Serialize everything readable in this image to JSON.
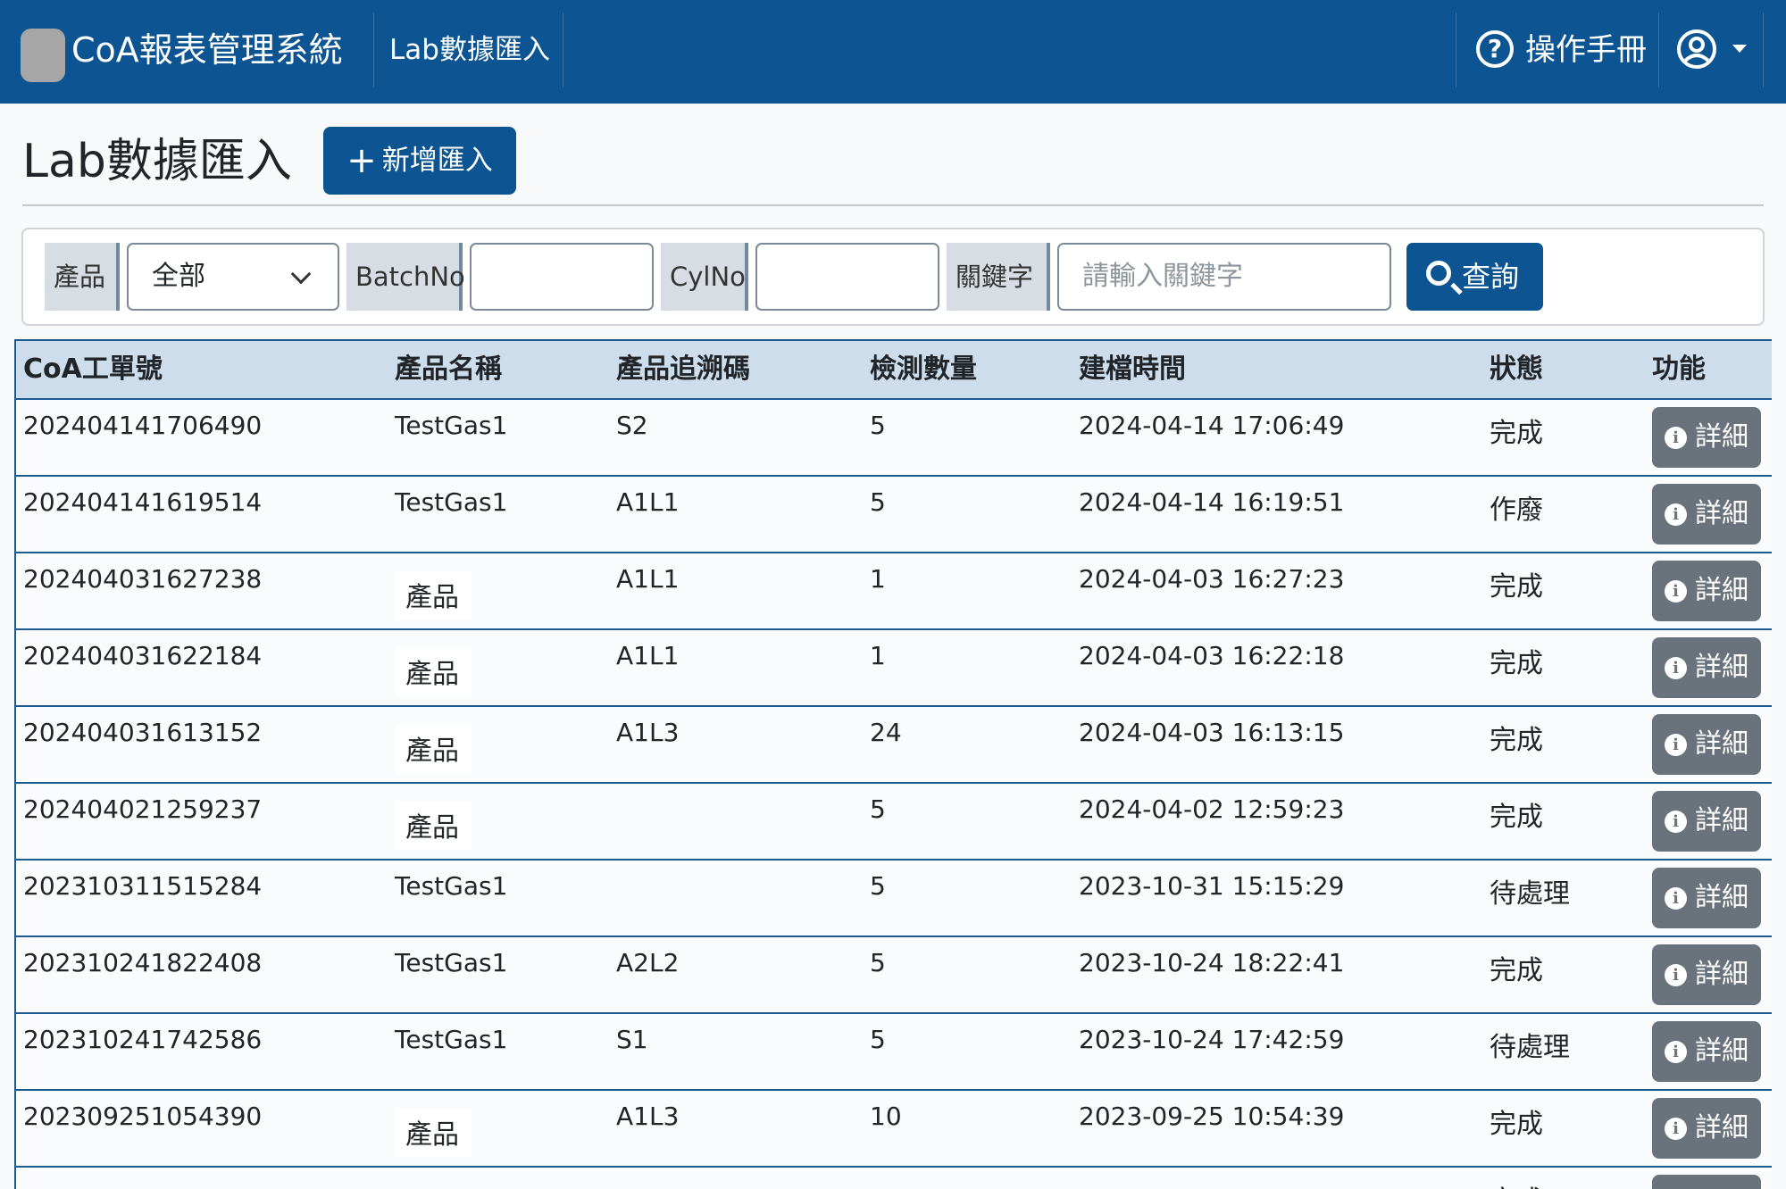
{
  "header": {
    "app_title": "CoA報表管理系統",
    "nav_link": "Lab數據匯入",
    "help_label": "操作手冊",
    "help_icon": "question-circle-icon",
    "user_icon": "user-circle-icon"
  },
  "page": {
    "title": "Lab數據匯入",
    "add_button": "新增匯入"
  },
  "filters": {
    "product_label": "產品",
    "product_value": "全部",
    "batch_label": "BatchNo",
    "batch_value": "",
    "cyl_label": "CylNo",
    "cyl_value": "",
    "keyword_label": "關鍵字",
    "keyword_placeholder": "請輸入關鍵字",
    "search_button": "查詢"
  },
  "table": {
    "columns": [
      "CoA工單號",
      "產品名稱",
      "產品追溯碼",
      "檢測數量",
      "建檔時間",
      "狀態",
      "功能"
    ],
    "detail_label": "詳細",
    "rows": [
      {
        "order": "202404141706490",
        "product": "TestGas1",
        "trace": "S2",
        "qty": "5",
        "created": "2024-04-14 17:06:49",
        "status": "完成"
      },
      {
        "order": "202404141619514",
        "product": "TestGas1",
        "trace": "A1L1",
        "qty": "5",
        "created": "2024-04-14 16:19:51",
        "status": "作廢"
      },
      {
        "order": "202404031627238",
        "product": "產品",
        "trace": "A1L1",
        "qty": "1",
        "created": "2024-04-03 16:27:23",
        "status": "完成"
      },
      {
        "order": "202404031622184",
        "product": "產品",
        "trace": "A1L1",
        "qty": "1",
        "created": "2024-04-03 16:22:18",
        "status": "完成"
      },
      {
        "order": "202404031613152",
        "product": "產品",
        "trace": "A1L3",
        "qty": "24",
        "created": "2024-04-03 16:13:15",
        "status": "完成"
      },
      {
        "order": "202404021259237",
        "product": "產品",
        "trace": "",
        "qty": "5",
        "created": "2024-04-02 12:59:23",
        "status": "完成"
      },
      {
        "order": "202310311515284",
        "product": "TestGas1",
        "trace": "",
        "qty": "5",
        "created": "2023-10-31 15:15:29",
        "status": "待處理"
      },
      {
        "order": "202310241822408",
        "product": "TestGas1",
        "trace": "A2L2",
        "qty": "5",
        "created": "2023-10-24 18:22:41",
        "status": "完成"
      },
      {
        "order": "202310241742586",
        "product": "TestGas1",
        "trace": "S1",
        "qty": "5",
        "created": "2023-10-24 17:42:59",
        "status": "待處理"
      },
      {
        "order": "202309251054390",
        "product": "產品",
        "trace": "A1L3",
        "qty": "10",
        "created": "2023-09-25 10:54:39",
        "status": "完成"
      },
      {
        "order": "",
        "product": "",
        "trace": "",
        "qty": "",
        "created": "",
        "status": "完成"
      }
    ]
  },
  "colors": {
    "brand": "#0d5592",
    "header_row": "#cdddec",
    "detail_button": "#6a737b"
  }
}
